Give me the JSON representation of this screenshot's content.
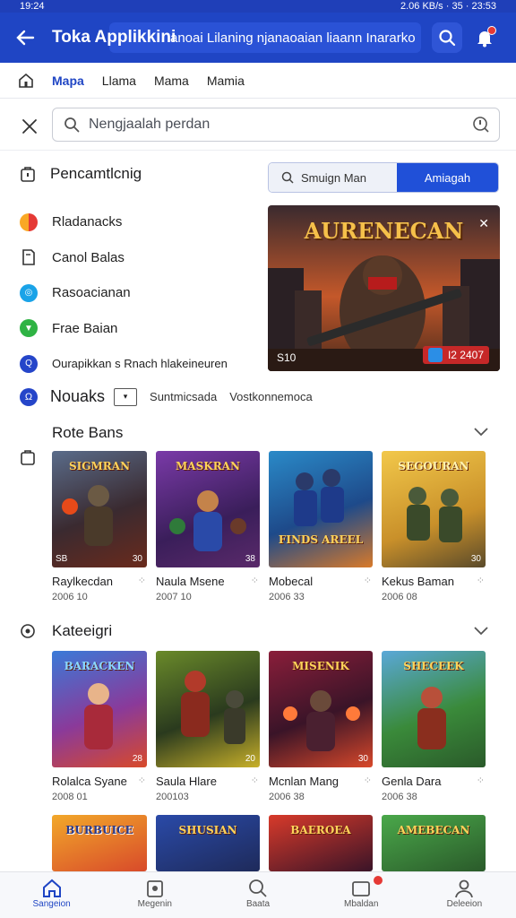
{
  "status": {
    "time": "19:24",
    "right": "2.06 KB/s  ·  35  ·  23:53"
  },
  "appbar": {
    "title": "Toka Applikkini",
    "subtitle": "anoai Lilaning njanaoaian liaann Inararko",
    "icons": [
      "back-arrow-icon",
      "search-icon",
      "bell-icon"
    ]
  },
  "tabs": [
    {
      "label": "Mapa",
      "active": true
    },
    {
      "label": "Llama",
      "active": false
    },
    {
      "label": "Mama",
      "active": false
    },
    {
      "label": "Mamia",
      "active": false
    }
  ],
  "search": {
    "placeholder": "Nengjaalah perdan"
  },
  "recommend": {
    "title": "Pencamtlcnig",
    "segment_left": "Smuign Man",
    "segment_right": "Amiagah"
  },
  "side_items": [
    {
      "label": "Rladanacks",
      "icon": "ring-icon",
      "color": "#e53935"
    },
    {
      "label": "Canol Balas",
      "icon": "document-icon",
      "color": ""
    },
    {
      "label": "Rasoacianan",
      "icon": "target-icon",
      "color": "#1aa3e8"
    },
    {
      "label": "Frae Baian",
      "icon": "shield-icon",
      "color": "#2fb344"
    },
    {
      "label": "Ourapikkan s Rnach hlakeineuren",
      "icon": "q-icon",
      "color": "#2545c9"
    }
  ],
  "banner": {
    "title": "AURENECAN",
    "left_label": "S10",
    "right_label": "I2 2407"
  },
  "noval": {
    "title": "Nouaks",
    "t1": "Suntmicsada",
    "t2": "Vostkonnemoca"
  },
  "section1": {
    "title": "Rote Bans",
    "cards": [
      {
        "name": "Raylkecdan",
        "year": "2006 10",
        "art": "SIGMRAN",
        "tag_l": "SB",
        "tag_r": "30"
      },
      {
        "name": "Naula Msene",
        "year": "2007 10",
        "art": "MASKRAN",
        "tag_l": "",
        "tag_r": "38"
      },
      {
        "name": "Mobecal",
        "year": "2006 33",
        "art": "FINDS AREEL",
        "tag_l": "",
        "tag_r": ""
      },
      {
        "name": "Kekus Baman",
        "year": "2006 08",
        "art": "SEGOURAN",
        "tag_l": "",
        "tag_r": "30"
      }
    ]
  },
  "section2": {
    "title": "Kateeigri",
    "cards": [
      {
        "name": "Rolalca Syane",
        "year": "2008 01",
        "art": "BARACKEN",
        "tag_l": "",
        "tag_r": "28"
      },
      {
        "name": "Saula Hlare",
        "year": "200103",
        "art": "",
        "tag_l": "",
        "tag_r": "20"
      },
      {
        "name": "Mcnlan Mang",
        "year": "2006 38",
        "art": "MISENIK",
        "tag_l": "",
        "tag_r": "30"
      },
      {
        "name": "Genla Dara",
        "year": "2006 38",
        "art": "SHECEEK",
        "tag_l": "",
        "tag_r": ""
      }
    ]
  },
  "section3": {
    "cards": [
      {
        "art": "BURBUICE"
      },
      {
        "art": "SHUSIAN"
      },
      {
        "art": "BAEROEA"
      },
      {
        "art": "AMEBECAN"
      }
    ]
  },
  "bottomnav": [
    {
      "label": "Sangeion",
      "icon": "home-icon",
      "active": true
    },
    {
      "label": "Megenin",
      "icon": "clipboard-icon",
      "active": false
    },
    {
      "label": "Baata",
      "icon": "search-icon",
      "active": false
    },
    {
      "label": "Mbaldan",
      "icon": "inbox-icon",
      "active": false
    },
    {
      "label": "Deleeion",
      "icon": "user-icon",
      "active": false
    }
  ],
  "colors": {
    "primary": "#1f45c4",
    "accent": "#2050d8",
    "badge": "#e53935"
  }
}
